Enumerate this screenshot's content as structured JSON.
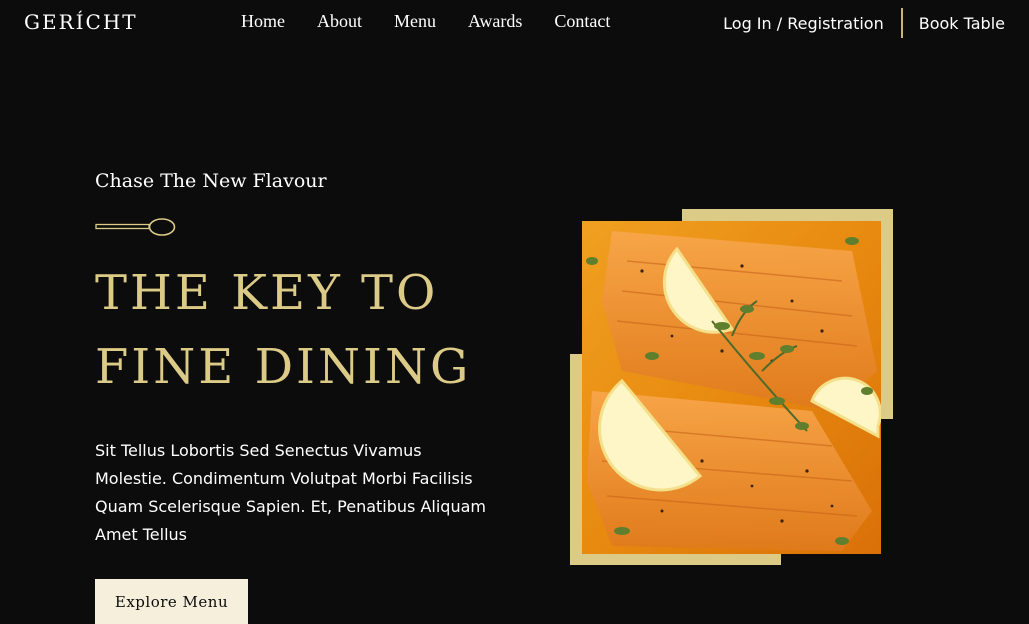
{
  "nav": {
    "logo": "GERÍCHT",
    "links": [
      "Home",
      "About",
      "Menu",
      "Awards",
      "Contact"
    ],
    "login": "Log In / Registration",
    "book_table": "Book Table"
  },
  "hero": {
    "subtitle": "Chase The New Flavour",
    "headline_lines": [
      "THE KEY TO",
      "FINE DINING"
    ],
    "description": "Sit Tellus Lobortis Sed Senectus Vivamus Molestie. Condimentum Volutpat Morbi Facilisis Quam Scelerisque Sapien. Et, Penatibus Aliquam Amet Tellus",
    "button_label": "Explore Menu"
  },
  "colors": {
    "background": "#0c0c0c",
    "accent_gold": "#dcca87",
    "button_bg": "#f5efdb",
    "text": "#ffffff"
  },
  "icons": {
    "spoon": "spoon-icon"
  }
}
